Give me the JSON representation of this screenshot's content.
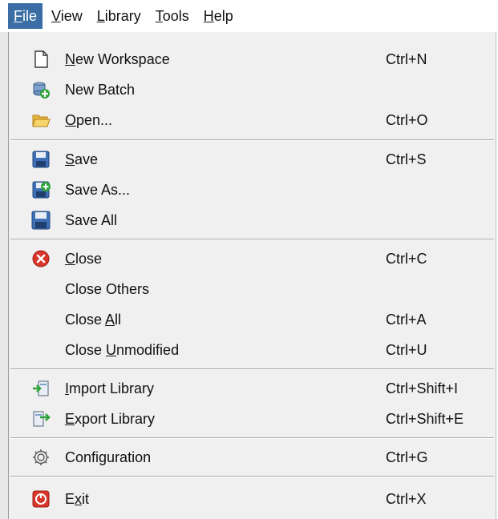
{
  "menubar": {
    "items": [
      {
        "label": "File",
        "u": "F",
        "rest": "ile"
      },
      {
        "label": "View",
        "u": "V",
        "rest": "iew"
      },
      {
        "label": "Library",
        "u": "L",
        "rest": "ibrary"
      },
      {
        "label": "Tools",
        "u": "T",
        "rest": "ools"
      },
      {
        "label": "Help",
        "u": "H",
        "rest": "elp"
      }
    ],
    "active_color": "#3a6ea5"
  },
  "file_menu": {
    "items": [
      {
        "icon": "new-document-icon",
        "pre": "",
        "u": "N",
        "post": "ew Workspace",
        "shortcut": "Ctrl+N"
      },
      {
        "icon": "new-batch-icon",
        "pre": "New Batch",
        "u": "",
        "post": "",
        "shortcut": ""
      },
      {
        "icon": "open-folder-icon",
        "pre": "",
        "u": "O",
        "post": "pen...",
        "shortcut": "Ctrl+O"
      },
      {
        "icon": "save-disk-icon",
        "pre": "",
        "u": "S",
        "post": "ave",
        "shortcut": "Ctrl+S"
      },
      {
        "icon": "save-as-icon",
        "pre": "Save As...",
        "u": "",
        "post": "",
        "shortcut": ""
      },
      {
        "icon": "save-all-icon",
        "pre": "Save All",
        "u": "",
        "post": "",
        "shortcut": ""
      },
      {
        "icon": "close-icon",
        "pre": "",
        "u": "C",
        "post": "lose",
        "shortcut": "Ctrl+C"
      },
      {
        "icon": "",
        "pre": "Close Others",
        "u": "",
        "post": "",
        "shortcut": ""
      },
      {
        "icon": "",
        "pre": "Close ",
        "u": "A",
        "post": "ll",
        "shortcut": "Ctrl+A"
      },
      {
        "icon": "",
        "pre": "Close ",
        "u": "U",
        "post": "nmodified",
        "shortcut": "Ctrl+U"
      },
      {
        "icon": "import-icon",
        "pre": "",
        "u": "I",
        "post": "mport Library",
        "shortcut": "Ctrl+Shift+I"
      },
      {
        "icon": "export-icon",
        "pre": "",
        "u": "E",
        "post": "xport Library",
        "shortcut": "Ctrl+Shift+E"
      },
      {
        "icon": "gear-icon",
        "pre": "Confi",
        "u": "g",
        "post": "uration",
        "shortcut": "Ctrl+G"
      },
      {
        "icon": "exit-icon",
        "pre": "E",
        "u": "x",
        "post": "it",
        "shortcut": "Ctrl+X"
      }
    ]
  }
}
